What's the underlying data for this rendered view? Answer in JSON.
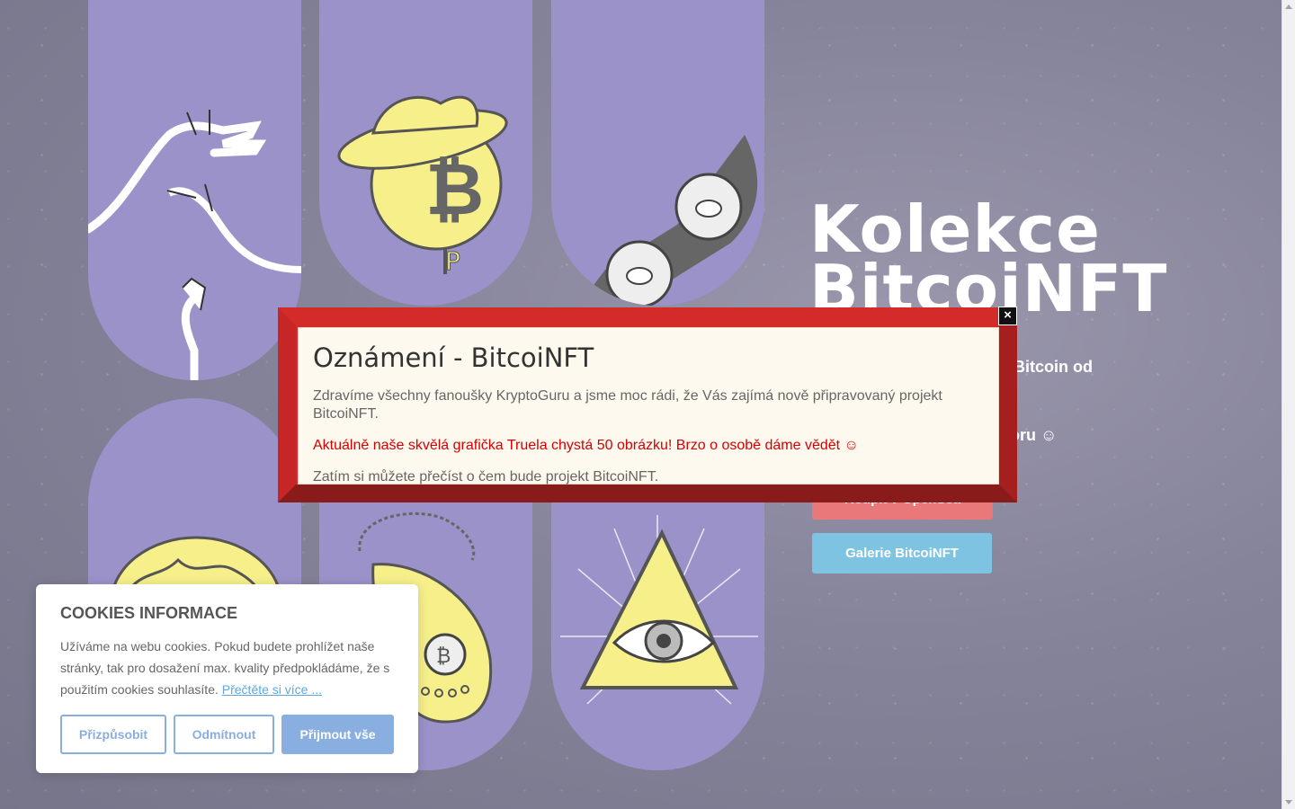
{
  "hero": {
    "title_line1": "Kolekce",
    "title_line2": "BitcoiNFT",
    "subtitle_fragment": "a Bitcoin od",
    "subtitle2_fragment": "poru ☺",
    "opensea_button": "Koupit v OpenSea",
    "gallery_button": "Galerie BitcoiNFT"
  },
  "modal": {
    "title": "Oznámení - BitcoiNFT",
    "paragraph1": "Zdravíme všechny fanoušky KryptoGuru a jsme moc rádi, že Vás zajímá nově připravovaný projekt BitcoiNFT.",
    "paragraph2": "Aktuálně naše skvělá grafička Truela chystá 50 obrázku! Brzo o osobě dáme vědět ☺",
    "paragraph3": "Zatím si můžete přečíst o čem bude projekt BitcoiNFT.",
    "close_symbol": "×"
  },
  "cookies": {
    "title": "COOKIES INFORMACE",
    "text": "Užíváme na webu cookies. Pokud budete prohlížet naše stránky, tak pro dosažení max. kvality předpokládáme, že s použitím cookies souhlasíte.",
    "link": "Přečtěte si více ...",
    "customize_button": "Přizpůsobit",
    "reject_button": "Odmítnout",
    "accept_button": "Přijmout vše"
  },
  "gallery": {
    "images": [
      "pointing-hands-icon",
      "bitcoin-hat-icon",
      "bitcoin-glasses-icon",
      "brain-icon",
      "bitcoin-purse-icon",
      "all-seeing-eye-icon"
    ]
  },
  "colors": {
    "accent_red": "#d32a2a",
    "opensea_button": "#e8787a",
    "gallery_button": "#7ec4e2",
    "cookie_button": "#89aee0",
    "pill_bg": "#9a92c8"
  }
}
